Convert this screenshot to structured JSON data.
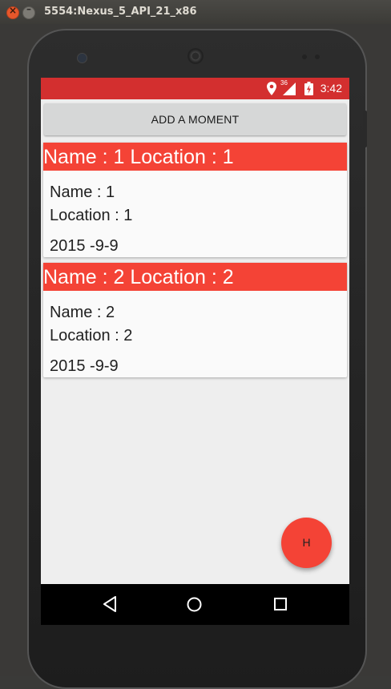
{
  "window": {
    "title": "5554:Nexus_5_API_21_x86"
  },
  "statusbar": {
    "time": "3:42",
    "signal_label": "36"
  },
  "add_button": {
    "label": "ADD A MOMENT"
  },
  "cards": [
    {
      "header": "Name : 1 Location : 1",
      "name": "Name : 1",
      "location": "Location : 1",
      "date": "2015 -9-9"
    },
    {
      "header": "Name : 2 Location : 2",
      "name": "Name : 2",
      "location": "Location : 2",
      "date": "2015 -9-9"
    }
  ],
  "fab": {
    "label": "H"
  },
  "colors": {
    "statusbar": "#d32f2f",
    "card_header": "#f44336",
    "fab": "#f44336",
    "button": "#d6d7d7"
  },
  "icons": {
    "window_close": "close-icon",
    "window_minimize": "minimize-icon",
    "location": "location-pin-icon",
    "signal": "cell-signal-icon",
    "battery": "battery-charging-icon",
    "nav_back": "back-triangle-icon",
    "nav_home": "home-circle-icon",
    "nav_recents": "recents-square-icon"
  }
}
